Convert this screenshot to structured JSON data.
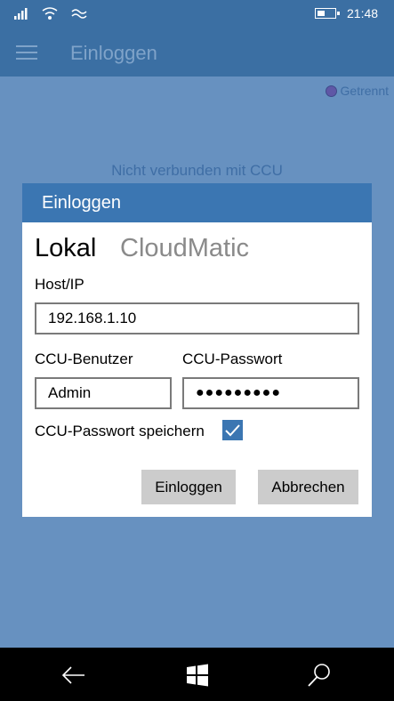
{
  "status_bar": {
    "time": "21:48",
    "icons": [
      "signal-icon",
      "wifi-icon",
      "wifi-secondary-icon",
      "battery-icon"
    ],
    "battery_level": 0.45
  },
  "header": {
    "title": "Einloggen",
    "menu_icon": "hamburger-icon"
  },
  "main": {
    "connection_status": "Getrennt",
    "connection_dot_color": "#5f57a6",
    "message": "Nicht verbunden mit CCU"
  },
  "dialog": {
    "title": "Einloggen",
    "tabs": [
      {
        "label": "Lokal",
        "selected": true
      },
      {
        "label": "CloudMatic",
        "selected": false
      }
    ],
    "host_label": "Host/IP",
    "host_value": "192.168.1.10",
    "user_label": "CCU-Benutzer",
    "user_value": "Admin",
    "password_label": "CCU-Passwort",
    "password_value": "●●●●●●●●●",
    "save_password_label": "CCU-Passwort speichern",
    "save_password_checked": true,
    "login_button": "Einloggen",
    "cancel_button": "Abbrechen"
  },
  "navbar": {
    "icons": [
      "back-icon",
      "windows-icon",
      "search-icon"
    ]
  },
  "colors": {
    "accent": "#3b76b2",
    "header": "#3b6fa3",
    "background": "#6791c0"
  }
}
